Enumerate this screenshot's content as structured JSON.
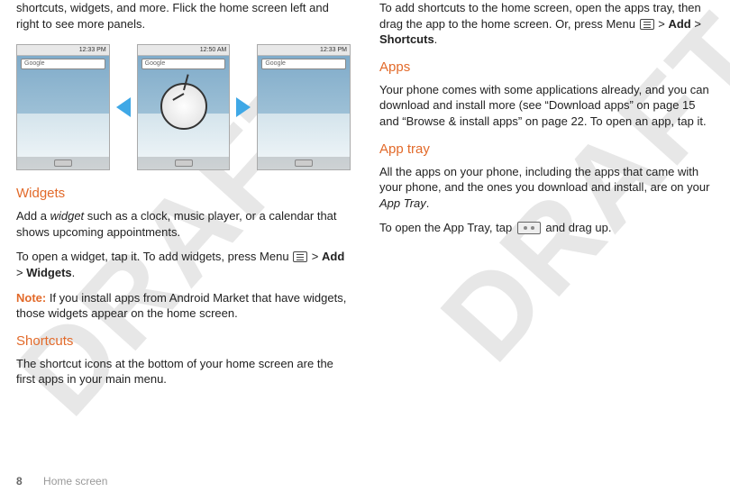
{
  "watermark": "DRAFT",
  "left": {
    "intro_cont": "shortcuts, widgets, and more. Flick the home screen left and right to see more panels.",
    "screens_time1": "12:33 PM",
    "screens_time2": "12:50 AM",
    "screens_time3": "12:33 PM",
    "google_hint": "Google",
    "widgets_heading": "Widgets",
    "widgets_p1a": "Add a ",
    "widgets_p1b_italic": "widget",
    "widgets_p1c": " such as a clock, music player, or a calendar that shows upcoming appointments.",
    "widgets_p2a": "To open a widget, tap it. To add widgets, press Menu ",
    "widgets_p2b_bold": "Add",
    "widgets_p2c_bold": "Widgets",
    "widgets_note_label": "Note:",
    "widgets_note_text": " If you install apps from Android Market that have widgets, those widgets appear on the home screen.",
    "shortcuts_heading": "Shortcuts",
    "shortcuts_p1": "The shortcut icons at the bottom of your home screen are the first apps in your main menu."
  },
  "right": {
    "shortcuts_p2a": "To add shortcuts to the home screen, open the apps tray, then drag the app to the home screen. Or, press Menu ",
    "shortcuts_p2b_bold": "Add",
    "shortcuts_p2c_bold": "Shortcuts",
    "apps_heading": "Apps",
    "apps_p1": "Your phone comes with some applications already, and you can download and install more (see “Download apps” on page 15 and “Browse & install apps” on page 22. To open an app, tap it.",
    "apptray_heading": "App tray",
    "apptray_p1a": "All the apps on your phone, including the apps that came with your phone, and the ones you download and install, are on your ",
    "apptray_p1b_italic": "App Tray",
    "apptray_p2a": "To open the App Tray, tap ",
    "apptray_p2b": " and drag up."
  },
  "footer": {
    "page_number": "8",
    "section": "Home screen"
  }
}
